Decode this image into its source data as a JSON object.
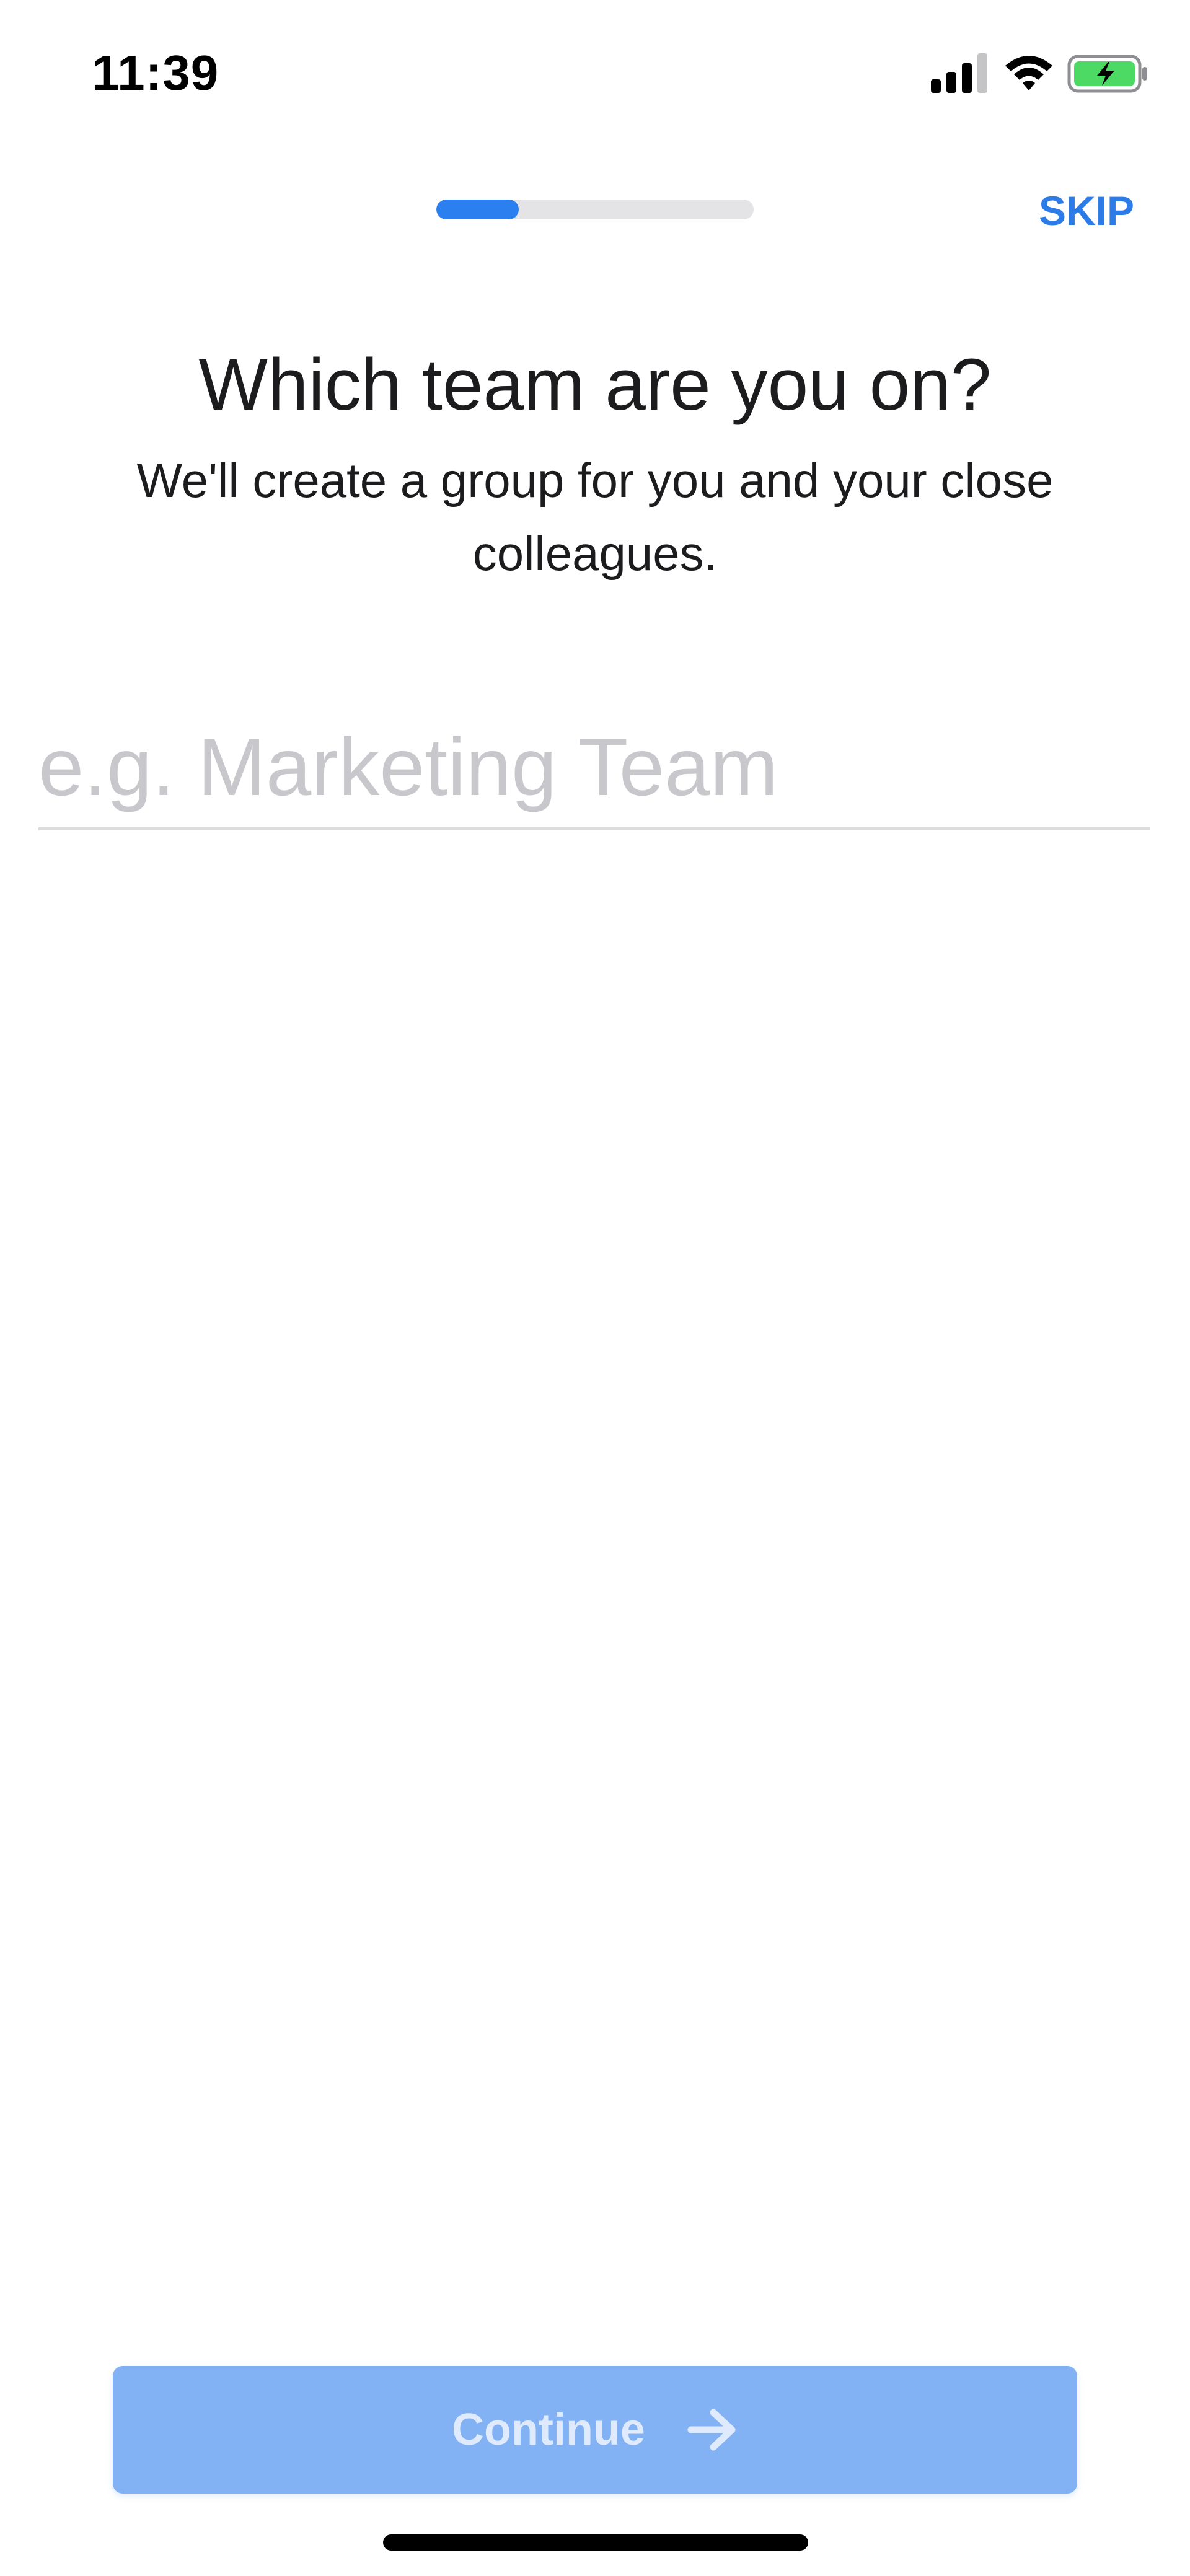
{
  "status_bar": {
    "time": "11:39",
    "icons": [
      "signal-icon",
      "wifi-icon",
      "battery-charging-icon"
    ]
  },
  "onboarding": {
    "progress_fraction": 0.26,
    "skip_label": "SKIP",
    "title": "Which team are you on?",
    "subtitle": "We'll create a group for you and your close colleagues.",
    "team_input": {
      "value": "",
      "placeholder": "e.g. Marketing Team"
    },
    "continue_label": "Continue",
    "continue_enabled": false
  },
  "colors": {
    "accent": "#2b7fef",
    "skip_text": "#2d7be6",
    "button_disabled": "#82b2f3",
    "placeholder": "#c7c7cc",
    "battery_fill": "#4cd964"
  }
}
